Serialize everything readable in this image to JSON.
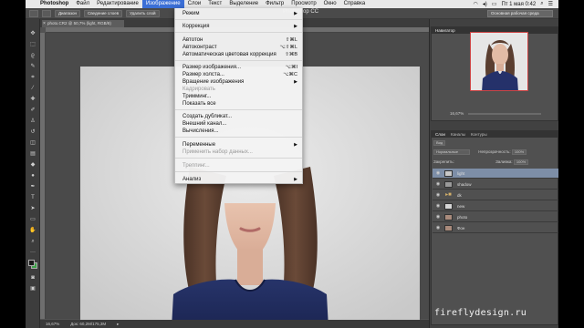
{
  "menubar": {
    "items": [
      "Photoshop",
      "Файл",
      "Редактирование",
      "Изображение",
      "Слои",
      "Текст",
      "Выделение",
      "Фильтр",
      "Просмотр",
      "Окно",
      "Справка"
    ],
    "clock": "Пт 1 мая 0:42"
  },
  "optbar": {
    "btn1": "Диапазон",
    "btn2": "Сведение слоев",
    "btn3": "Удалить слой",
    "ps_title": "Photoshop CC",
    "workspace": "Основная рабочая среда"
  },
  "doc": {
    "tab_label": "photo.CR2 @ 50,7% (light, RGB/8)"
  },
  "status": {
    "zoom": "16,67%",
    "doc_size": "Док: 60,2M/175,3M"
  },
  "navigator": {
    "tab_active": "Навигатор",
    "zoom": "16,67%"
  },
  "layers_panel": {
    "tabs": [
      "Слои",
      "Каналы",
      "Контуры"
    ],
    "kind": "Вид",
    "blend_mode": "Нормальные",
    "opacity_label": "Непрозрачность:",
    "opacity": "100%",
    "lock_label": "Закрепить:",
    "fill_label": "Заливка:",
    "fill": "100%",
    "layers": [
      {
        "name": "light",
        "selected": true,
        "type": "pixel"
      },
      {
        "name": "shadow",
        "selected": false,
        "type": "pixel"
      },
      {
        "name": "dk",
        "selected": false,
        "type": "group"
      },
      {
        "name": "new",
        "selected": false,
        "type": "pixel"
      },
      {
        "name": "photo",
        "selected": false,
        "type": "pixel"
      },
      {
        "name": "Фон",
        "selected": false,
        "type": "pixel"
      }
    ]
  },
  "image_menu": {
    "title": "Изображение",
    "items": [
      {
        "label": "Режим",
        "submenu": true
      },
      {
        "label": "Коррекция",
        "submenu": true
      },
      {
        "label": "Автотон",
        "shortcut": "⇧⌘L"
      },
      {
        "label": "Автоконтраст",
        "shortcut": "⌥⇧⌘L"
      },
      {
        "label": "Автоматическая цветовая коррекция",
        "shortcut": "⇧⌘B"
      },
      {
        "label": "Размер изображения...",
        "shortcut": "⌥⌘I"
      },
      {
        "label": "Размер холста...",
        "shortcut": "⌥⌘C"
      },
      {
        "label": "Вращение изображения",
        "submenu": true
      },
      {
        "label": "Кадрировать",
        "disabled": true
      },
      {
        "label": "Тримминг..."
      },
      {
        "label": "Показать все"
      },
      {
        "label": "Создать дубликат..."
      },
      {
        "label": "Внешний канал..."
      },
      {
        "label": "Вычисления..."
      },
      {
        "label": "Переменные",
        "submenu": true
      },
      {
        "label": "Применить набор данных...",
        "disabled": true
      },
      {
        "label": "Треппинг...",
        "disabled": true
      },
      {
        "label": "Анализ",
        "submenu": true
      }
    ]
  },
  "watermark": "fireflydesign.ru",
  "colors": {
    "menu_highlight": "#3b6fd6",
    "selected_layer": "#7d8ea7",
    "background_swatch": "#3fa14a"
  }
}
